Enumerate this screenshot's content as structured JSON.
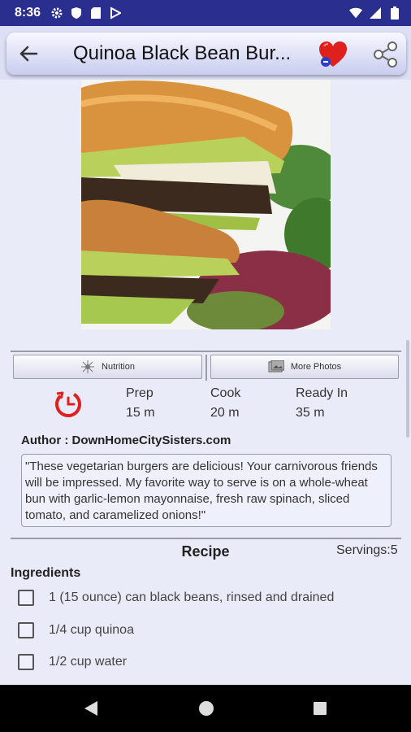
{
  "status_bar": {
    "time": "8:36",
    "left_icons": [
      "gear-icon",
      "shield-icon",
      "sd-card-icon",
      "play-store-icon"
    ],
    "right_icons": [
      "wifi-icon",
      "signal-icon",
      "battery-icon"
    ]
  },
  "app_bar": {
    "title": "Quinoa Black Bean Bur...",
    "back_icon": "arrow-left-icon",
    "favorite_icon": "heart-icon",
    "share_icon": "share-icon",
    "background": "#2a2f8f"
  },
  "photo": {
    "subject": "recipe photo"
  },
  "buttons": {
    "nutrition": "Nutrition",
    "more_photos": "More Photos"
  },
  "times": [
    {
      "label": "Prep",
      "value": "15 m"
    },
    {
      "label": "Cook",
      "value": "20 m"
    },
    {
      "label": "Ready In",
      "value": "35 m"
    }
  ],
  "author": "Author : DownHomeCitySisters.com",
  "description": "\"These vegetarian burgers are delicious! Your carnivorous friends will be impressed. My favorite way to serve is on a whole-wheat bun with garlic-lemon mayonnaise, fresh raw spinach, sliced tomato, and caramelized onions!\"",
  "recipe": {
    "title": "Recipe",
    "servings": "Servings:5",
    "ingredients_heading": "Ingredients",
    "ingredients": [
      "1 (15 ounce) can black beans, rinsed and drained",
      "1/4 cup quinoa",
      "1/2 cup water"
    ]
  },
  "colors": {
    "accent_red": "#e0201c",
    "bar_blue": "#2a2f8f"
  }
}
